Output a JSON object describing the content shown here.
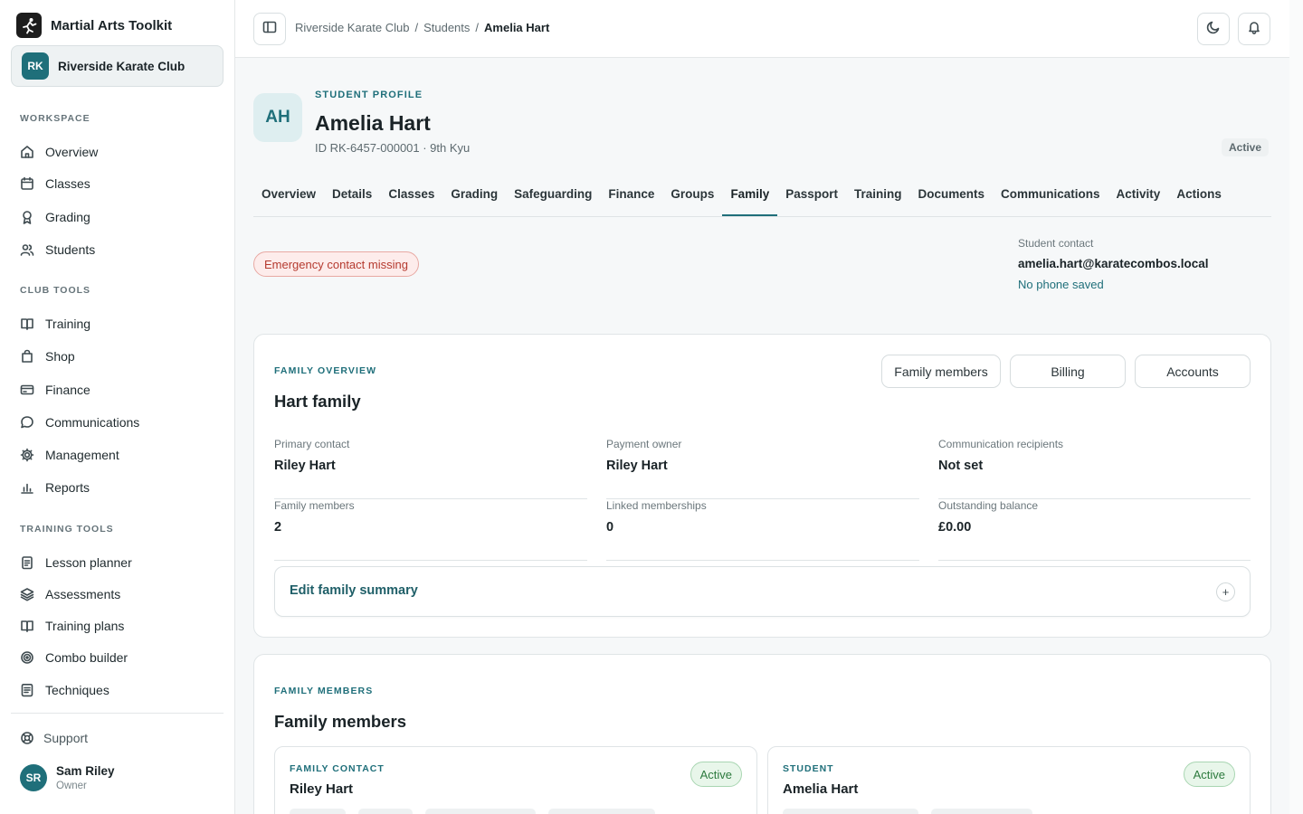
{
  "app": {
    "name": "Martial Arts Toolkit"
  },
  "club": {
    "initials": "RK",
    "name": "Riverside Karate Club"
  },
  "sidebar": {
    "workspace_heading": "WORKSPACE",
    "workspace": [
      {
        "label": "Overview",
        "icon": "home-icon"
      },
      {
        "label": "Classes",
        "icon": "calendar-icon"
      },
      {
        "label": "Grading",
        "icon": "award-icon"
      },
      {
        "label": "Students",
        "icon": "users-icon"
      }
    ],
    "club_tools_heading": "CLUB TOOLS",
    "club_tools": [
      {
        "label": "Training",
        "icon": "book-icon"
      },
      {
        "label": "Shop",
        "icon": "shopping-bag-icon"
      },
      {
        "label": "Finance",
        "icon": "credit-card-icon"
      },
      {
        "label": "Communications",
        "icon": "message-icon"
      },
      {
        "label": "Management",
        "icon": "gear-icon"
      },
      {
        "label": "Reports",
        "icon": "bar-chart-icon"
      }
    ],
    "training_tools_heading": "TRAINING TOOLS",
    "training_tools": [
      {
        "label": "Lesson planner",
        "icon": "clipboard-icon"
      },
      {
        "label": "Assessments",
        "icon": "layers-icon"
      },
      {
        "label": "Training plans",
        "icon": "book-icon"
      },
      {
        "label": "Combo builder",
        "icon": "target-icon"
      },
      {
        "label": "Techniques",
        "icon": "document-icon"
      }
    ],
    "support": "Support",
    "user": {
      "initials": "SR",
      "name": "Sam Riley",
      "role": "Owner"
    }
  },
  "breadcrumb": [
    "Riverside Karate Club",
    "Students",
    "Amelia Hart"
  ],
  "breadcrumb_sep": "/",
  "profile": {
    "eyebrow": "STUDENT PROFILE",
    "initials": "AH",
    "name": "Amelia Hart",
    "meta": "ID RK-6457-000001 · 9th Kyu",
    "status": "Active"
  },
  "tabs": [
    "Overview",
    "Details",
    "Classes",
    "Grading",
    "Safeguarding",
    "Finance",
    "Groups",
    "Family",
    "Passport",
    "Training",
    "Documents",
    "Communications",
    "Activity",
    "Actions"
  ],
  "active_tab": "Family",
  "alert": "Emergency contact missing",
  "contact": {
    "label": "Student contact",
    "email": "amelia.hart@karatecombos.local",
    "phone": "No phone saved"
  },
  "family_overview": {
    "eyebrow": "FAMILY OVERVIEW",
    "title": "Hart family",
    "buttons": [
      "Family members",
      "Billing",
      "Accounts"
    ],
    "fields": [
      {
        "label": "Primary contact",
        "value": "Riley Hart"
      },
      {
        "label": "Payment owner",
        "value": "Riley Hart"
      },
      {
        "label": "Communication recipients",
        "value": "Not set"
      },
      {
        "label": "Family members",
        "value": "2"
      },
      {
        "label": "Linked memberships",
        "value": "0"
      },
      {
        "label": "Outstanding balance",
        "value": "£0.00"
      }
    ],
    "edit_label": "Edit family summary",
    "edit_icon": "+"
  },
  "family_members": {
    "eyebrow": "FAMILY MEMBERS",
    "title": "Family members",
    "members": [
      {
        "role": "FAMILY CONTACT",
        "name": "Riley Hart",
        "status": "Active"
      },
      {
        "role": "STUDENT",
        "name": "Amelia Hart",
        "status": "Active"
      }
    ]
  },
  "colors": {
    "accent": "#1f6f7a",
    "alert": "#b53a2f",
    "success": "#2c7a3d"
  }
}
